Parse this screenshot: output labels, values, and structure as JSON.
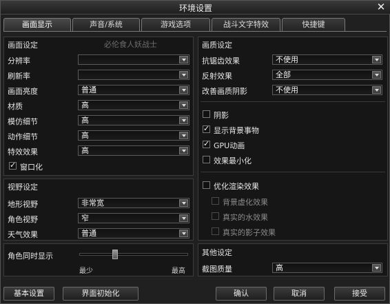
{
  "window": {
    "title": "环境设置",
    "close_glyph": "✕"
  },
  "tabs": [
    "画面显示",
    "声音/系统",
    "游戏选项",
    "战斗文字特效",
    "快捷键"
  ],
  "background_text": "必伦食人妖战士",
  "left": {
    "display_section": {
      "title": "画面设定",
      "rows": [
        {
          "label": "分辨率",
          "value": ""
        },
        {
          "label": "刷新率",
          "value": ""
        },
        {
          "label": "画面亮度",
          "value": "普通"
        },
        {
          "label": "材质",
          "value": "高"
        },
        {
          "label": "模仿细节",
          "value": "高"
        },
        {
          "label": "动作细节",
          "value": "高"
        },
        {
          "label": "特效效果",
          "value": "高"
        }
      ],
      "windowed": {
        "label": "窗口化",
        "checked": true
      }
    },
    "view_section": {
      "title": "视野设定",
      "rows": [
        {
          "label": "地形视野",
          "value": "非常宽"
        },
        {
          "label": "角色视野",
          "value": "窄"
        },
        {
          "label": "天气效果",
          "value": "普通"
        }
      ]
    },
    "characters_slider": {
      "label": "角色同时显示",
      "min_label": "最少",
      "max_label": "最高",
      "level": 0.32
    }
  },
  "right": {
    "quality_section": {
      "title": "画质设定",
      "rows": [
        {
          "label": "抗锯齿效果",
          "value": "不使用"
        },
        {
          "label": "反射效果",
          "value": "全部"
        },
        {
          "label": "改善画质阴影",
          "value": "不使用"
        }
      ],
      "checkboxes": [
        {
          "label": "阴影",
          "checked": false,
          "disabled": false
        },
        {
          "label": "显示背景事物",
          "checked": true,
          "disabled": false
        },
        {
          "label": "GPU动画",
          "checked": true,
          "disabled": false
        },
        {
          "label": "效果最小化",
          "checked": false,
          "disabled": false
        }
      ],
      "render_opt": {
        "label": "优化渲染效果",
        "checked": false
      },
      "sub_checkboxes": [
        {
          "label": "背景虚化效果",
          "checked": false
        },
        {
          "label": "真实的水效果",
          "checked": false
        },
        {
          "label": "真实的影子效果",
          "checked": false
        }
      ]
    },
    "other_section": {
      "title": "其他设定",
      "rows": [
        {
          "label": "截图质量",
          "value": "高"
        }
      ]
    }
  },
  "buttons": {
    "basic": "基本设置",
    "reset": "界面初始化",
    "confirm": "确认",
    "cancel": "取消",
    "accept": "接受"
  }
}
